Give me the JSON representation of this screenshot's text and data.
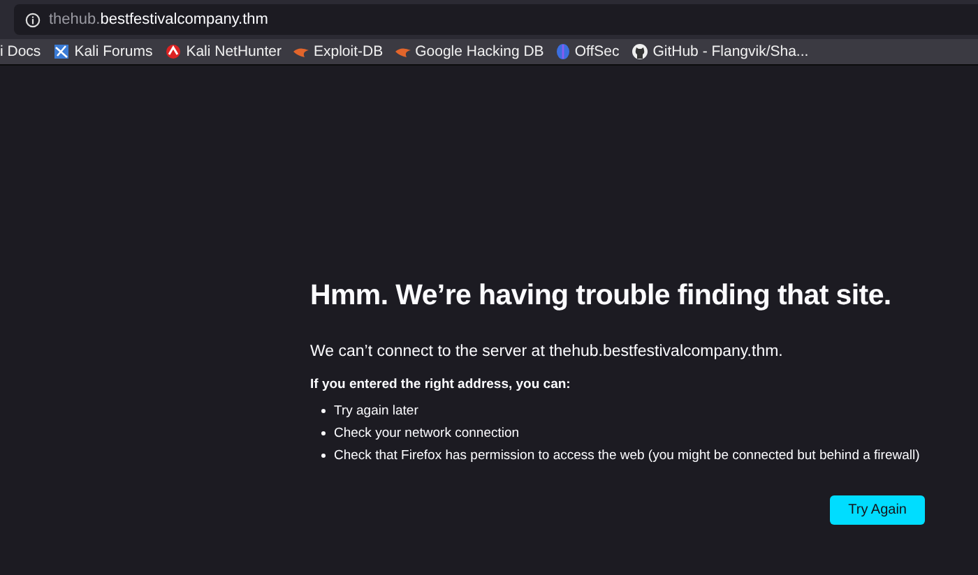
{
  "address_bar": {
    "subdomain": "thehub.",
    "domain": "bestfestivalcompany.thm"
  },
  "bookmarks": [
    {
      "label": "i Docs",
      "kind": "plain"
    },
    {
      "label": "Kali Forums",
      "kind": "kali"
    },
    {
      "label": "Kali NetHunter",
      "kind": "nethunter"
    },
    {
      "label": "Exploit-DB",
      "kind": "flame"
    },
    {
      "label": "Google Hacking DB",
      "kind": "flame"
    },
    {
      "label": "OffSec",
      "kind": "offsec"
    },
    {
      "label": "GitHub - Flangvik/Sha...",
      "kind": "github"
    }
  ],
  "error_page": {
    "title": "Hmm. We’re having trouble finding that site.",
    "message": "We can’t connect to the server at thehub.bestfestivalcompany.thm.",
    "subtitle": "If you entered the right address, you can:",
    "suggestions": [
      "Try again later",
      "Check your network connection",
      "Check that Firefox has permission to access the web (you might be connected but behind a firewall)"
    ],
    "button": "Try Again"
  }
}
